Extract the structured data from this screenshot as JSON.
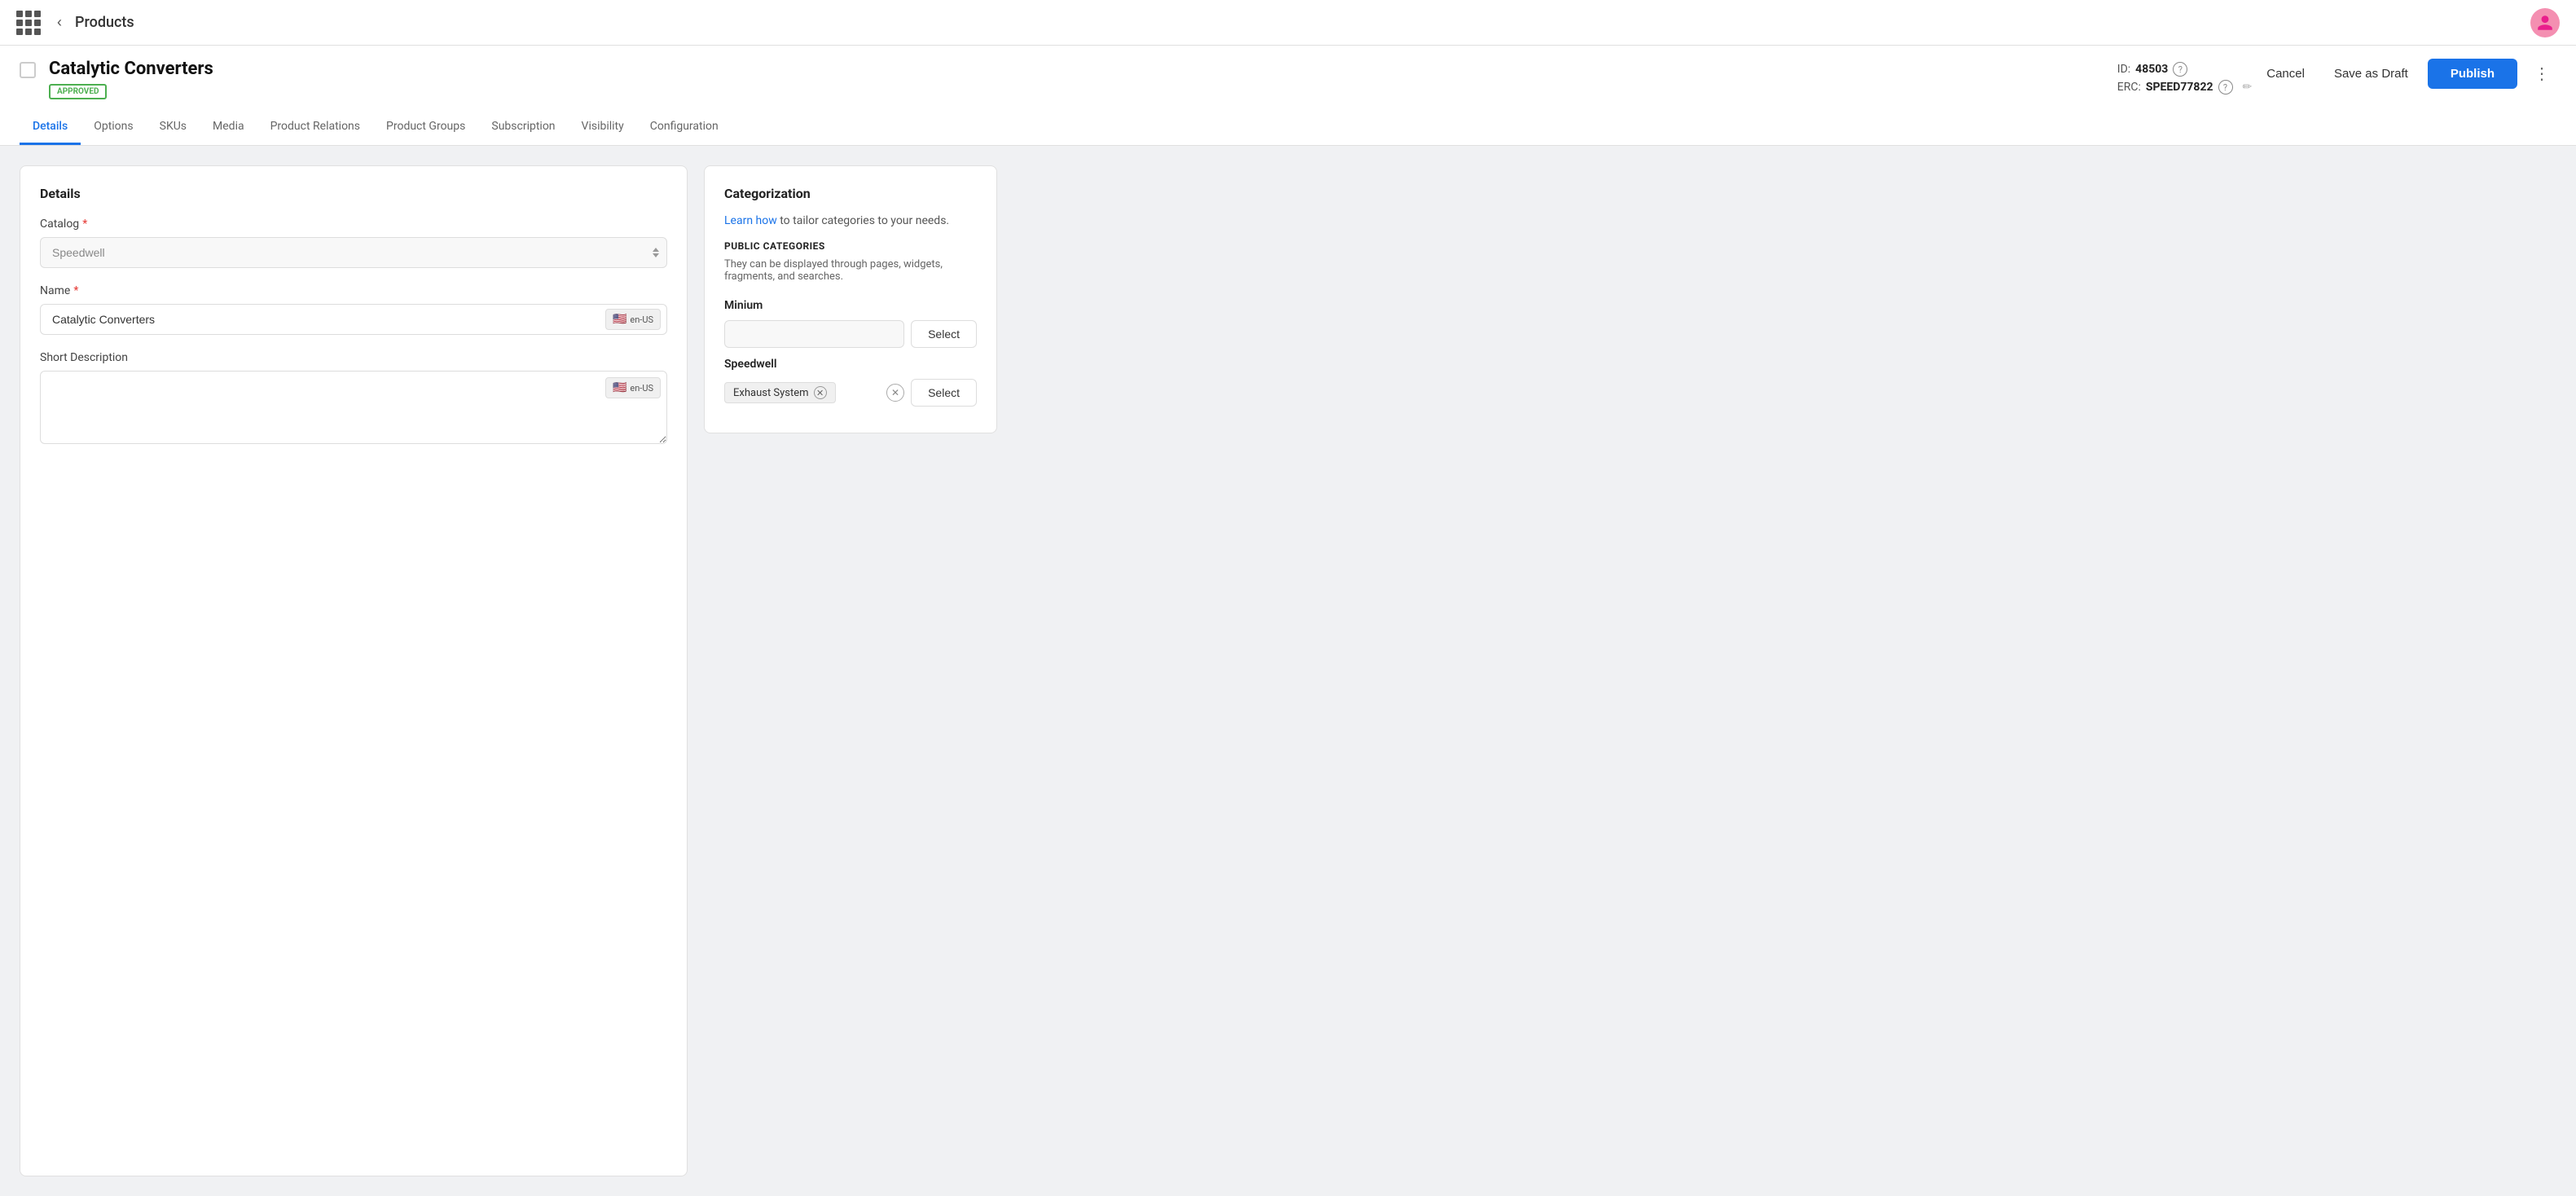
{
  "nav": {
    "title": "Products",
    "back_label": "‹"
  },
  "product": {
    "name": "Catalytic Converters",
    "status": "APPROVED",
    "id_label": "ID:",
    "id_value": "48503",
    "erc_label": "ERC:",
    "erc_value": "SPEED77822"
  },
  "actions": {
    "cancel_label": "Cancel",
    "draft_label": "Save as Draft",
    "publish_label": "Publish",
    "more_label": "⋮"
  },
  "tabs": [
    {
      "id": "details",
      "label": "Details",
      "active": true
    },
    {
      "id": "options",
      "label": "Options",
      "active": false
    },
    {
      "id": "skus",
      "label": "SKUs",
      "active": false
    },
    {
      "id": "media",
      "label": "Media",
      "active": false
    },
    {
      "id": "product-relations",
      "label": "Product Relations",
      "active": false
    },
    {
      "id": "product-groups",
      "label": "Product Groups",
      "active": false
    },
    {
      "id": "subscription",
      "label": "Subscription",
      "active": false
    },
    {
      "id": "visibility",
      "label": "Visibility",
      "active": false
    },
    {
      "id": "configuration",
      "label": "Configuration",
      "active": false
    }
  ],
  "details": {
    "panel_title": "Details",
    "catalog": {
      "label": "Catalog",
      "placeholder": "Speedwell"
    },
    "name": {
      "label": "Name",
      "value": "Catalytic Converters",
      "locale": "en-US"
    },
    "short_description": {
      "label": "Short Description",
      "value": "",
      "locale": "en-US"
    }
  },
  "categorization": {
    "panel_title": "Categorization",
    "learn_text": "Learn how",
    "learn_suffix": " to tailor categories to your needs.",
    "public_label": "PUBLIC CATEGORIES",
    "public_desc": "They can be displayed through pages, widgets, fragments, and searches.",
    "minium_label": "Minium",
    "speedwell_label": "Speedwell",
    "speedwell_tag": "Exhaust System",
    "select_label": "Select"
  }
}
